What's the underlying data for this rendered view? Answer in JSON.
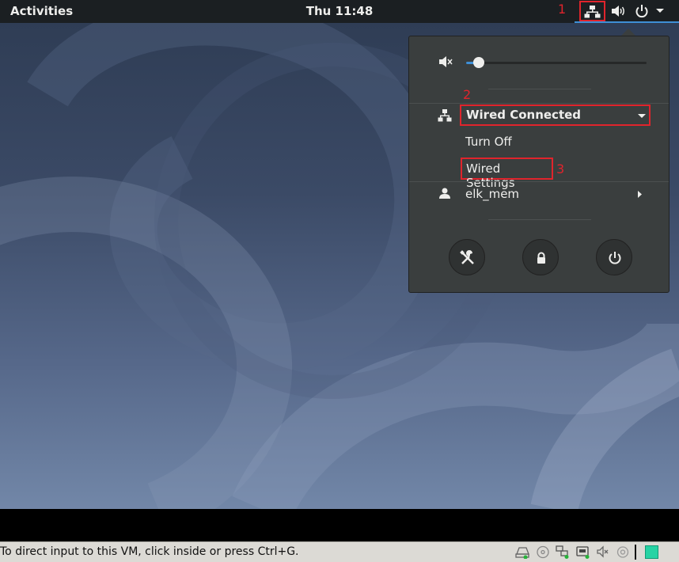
{
  "topbar": {
    "activities_label": "Activities",
    "clock": "Thu 11:48"
  },
  "annotations": {
    "step1": "1",
    "step2": "2",
    "step3": "3"
  },
  "menu": {
    "volume": {
      "level_percent": 7,
      "icon": "volume-muted-icon"
    },
    "network": {
      "status_label": "Wired Connected",
      "turn_off_label": "Turn Off",
      "settings_label": "Wired Settings",
      "icon": "wired-network-icon"
    },
    "user": {
      "name": "elk_mem",
      "icon": "user-icon"
    },
    "buttons": [
      "settings-icon",
      "lock-icon",
      "power-icon"
    ]
  },
  "vm_statusbar": {
    "message": "To direct input to this VM, click inside or press Ctrl+G."
  },
  "colors": {
    "topbar_bg": "#1b1f22",
    "menu_bg": "#3a3e3e",
    "accent": "#3e8fd6",
    "annotation": "#e0242c"
  }
}
